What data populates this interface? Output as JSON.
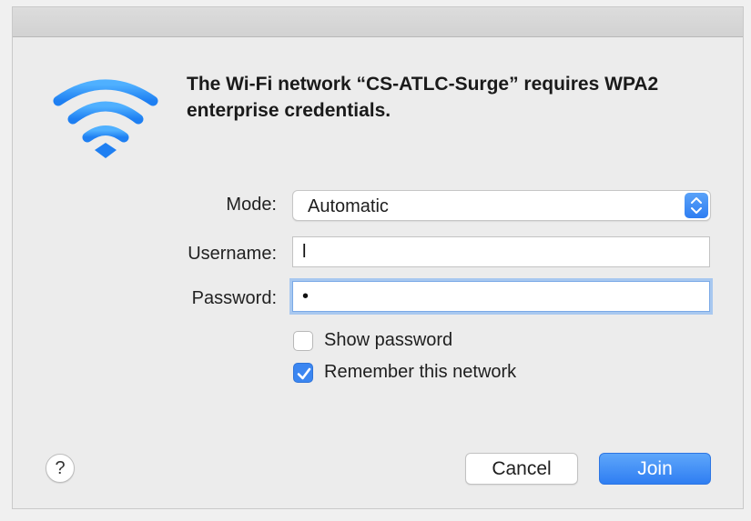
{
  "dialog": {
    "headline": "The Wi-Fi network “CS-ATLC-Surge” requires WPA2 enterprise credentials.",
    "icon": "wifi-icon",
    "accent_color": "#3b86f1"
  },
  "form": {
    "mode_label": "Mode:",
    "mode_value": "Automatic",
    "username_label": "Username:",
    "username_value": "l",
    "password_label": "Password:",
    "password_value": "•"
  },
  "options": {
    "show_password_label": "Show password",
    "show_password_checked": false,
    "remember_label": "Remember this network",
    "remember_checked": true
  },
  "buttons": {
    "help_label": "?",
    "cancel_label": "Cancel",
    "join_label": "Join"
  }
}
